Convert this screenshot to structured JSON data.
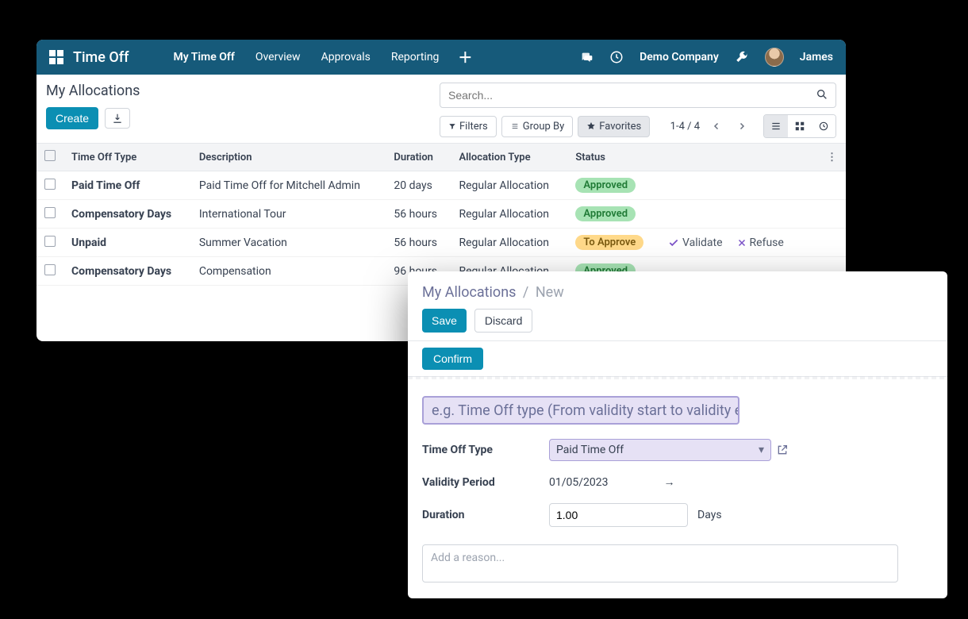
{
  "topbar": {
    "app_title": "Time Off",
    "nav": [
      "My Time Off",
      "Overview",
      "Approvals",
      "Reporting"
    ],
    "company": "Demo Company",
    "username": "James"
  },
  "page": {
    "title": "My Allocations",
    "create_label": "Create",
    "search_placeholder": "Search...",
    "filters_label": "Filters",
    "groupby_label": "Group By",
    "favorites_label": "Favorites",
    "pager": "1-4 / 4"
  },
  "table": {
    "headers": {
      "type": "Time Off Type",
      "description": "Description",
      "duration": "Duration",
      "alloc_type": "Allocation Type",
      "status": "Status"
    },
    "rows": [
      {
        "type": "Paid Time Off",
        "description": "Paid Time Off for Mitchell Admin",
        "duration": "20 days",
        "alloc_type": "Regular Allocation",
        "status": "Approved",
        "status_cls": "badge-green"
      },
      {
        "type": "Compensatory Days",
        "description": "International Tour",
        "duration": "56 hours",
        "alloc_type": "Regular Allocation",
        "status": "Approved",
        "status_cls": "badge-green"
      },
      {
        "type": "Unpaid",
        "description": "Summer Vacation",
        "duration": "56 hours",
        "alloc_type": "Regular Allocation",
        "status": "To Approve",
        "status_cls": "badge-yellow",
        "actions": true
      },
      {
        "type": "Compensatory Days",
        "description": "Compensation",
        "duration": "96 hours",
        "alloc_type": "Regular Allocation",
        "status": "Approved",
        "status_cls": "badge-green"
      }
    ],
    "action_validate": "Validate",
    "action_refuse": "Refuse"
  },
  "form": {
    "breadcrumb_root": "My Allocations",
    "breadcrumb_leaf": "New",
    "save_label": "Save",
    "discard_label": "Discard",
    "confirm_label": "Confirm",
    "name_placeholder": "e.g. Time Off type (From validity start to validity end)",
    "labels": {
      "type": "Time Off Type",
      "validity": "Validity Period",
      "duration": "Duration"
    },
    "type_value": "Paid Time Off",
    "validity_start": "01/05/2023",
    "duration_value": "1.00",
    "duration_unit": "Days",
    "reason_placeholder": "Add a reason..."
  }
}
